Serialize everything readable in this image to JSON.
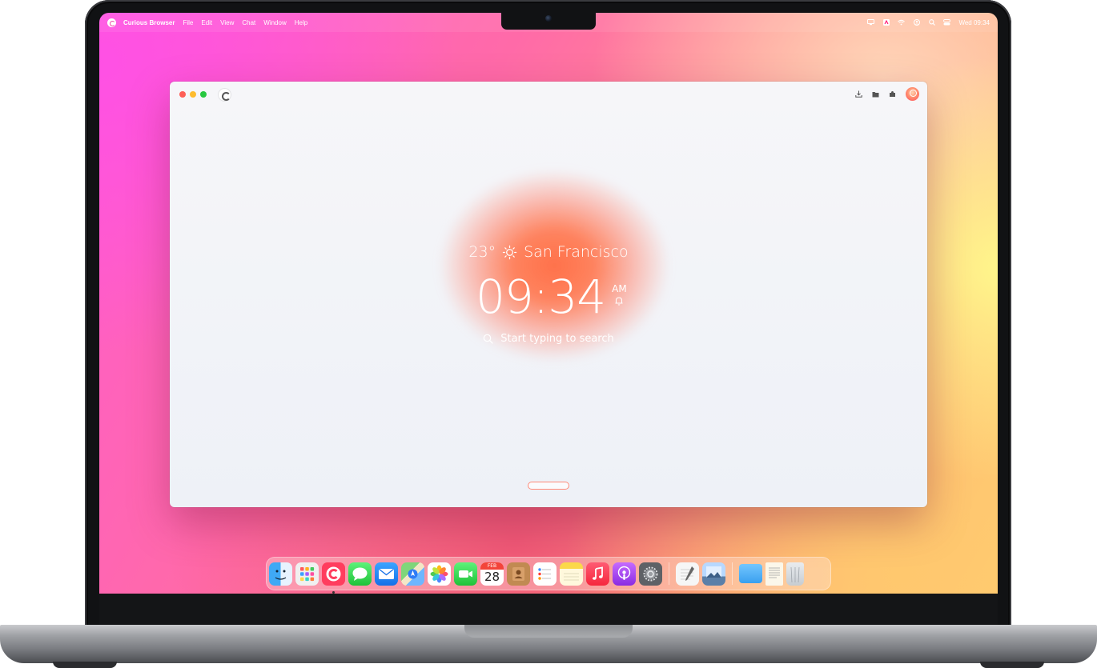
{
  "menubar": {
    "app_name": "Curious Browser",
    "items": [
      "File",
      "Edit",
      "View",
      "Chat",
      "Window",
      "Help"
    ],
    "status_icons": [
      "display-icon",
      "input-source-icon",
      "wifi-icon",
      "user-icon",
      "spotlight-search-icon",
      "control-center-icon"
    ],
    "clock": "Wed 09:34"
  },
  "browser": {
    "toolbar_icons": [
      "download-icon",
      "folder-icon",
      "extensions-icon",
      "profile-avatar"
    ],
    "weather": {
      "temperature": "23°",
      "condition_icon": "sun-icon",
      "city": "San Francisco"
    },
    "time": "09:34",
    "ampm": "AM",
    "alarm_icon": "bell-icon",
    "search_placeholder": "Start typing to search"
  },
  "dock": {
    "apps": [
      {
        "name": "Finder",
        "icon": "finder-icon"
      },
      {
        "name": "Launchpad",
        "icon": "launchpad-icon"
      },
      {
        "name": "Curious Browser",
        "icon": "curious-browser-icon",
        "running": true
      },
      {
        "name": "Messages",
        "icon": "messages-icon"
      },
      {
        "name": "Mail",
        "icon": "mail-icon"
      },
      {
        "name": "Maps",
        "icon": "maps-icon"
      },
      {
        "name": "Photos",
        "icon": "photos-icon"
      },
      {
        "name": "FaceTime",
        "icon": "facetime-icon"
      },
      {
        "name": "Calendar",
        "icon": "calendar-icon",
        "month": "FEB",
        "day": "28"
      },
      {
        "name": "Contacts",
        "icon": "contacts-icon"
      },
      {
        "name": "Reminders",
        "icon": "reminders-icon"
      },
      {
        "name": "Notes",
        "icon": "notes-icon"
      },
      {
        "name": "Music",
        "icon": "music-icon"
      },
      {
        "name": "Podcasts",
        "icon": "podcasts-icon"
      },
      {
        "name": "System Settings",
        "icon": "settings-icon"
      },
      {
        "name": "TextEdit",
        "icon": "textedit-icon"
      },
      {
        "name": "Preview",
        "icon": "preview-icon"
      },
      {
        "name": "Folder",
        "icon": "folder-icon"
      },
      {
        "name": "Document",
        "icon": "document-icon"
      },
      {
        "name": "Trash",
        "icon": "trash-icon"
      }
    ]
  },
  "colors": {
    "accent": "#ff6a4a",
    "traffic_red": "#fe5f57",
    "traffic_yellow": "#febc2e",
    "traffic_green": "#28c840"
  }
}
